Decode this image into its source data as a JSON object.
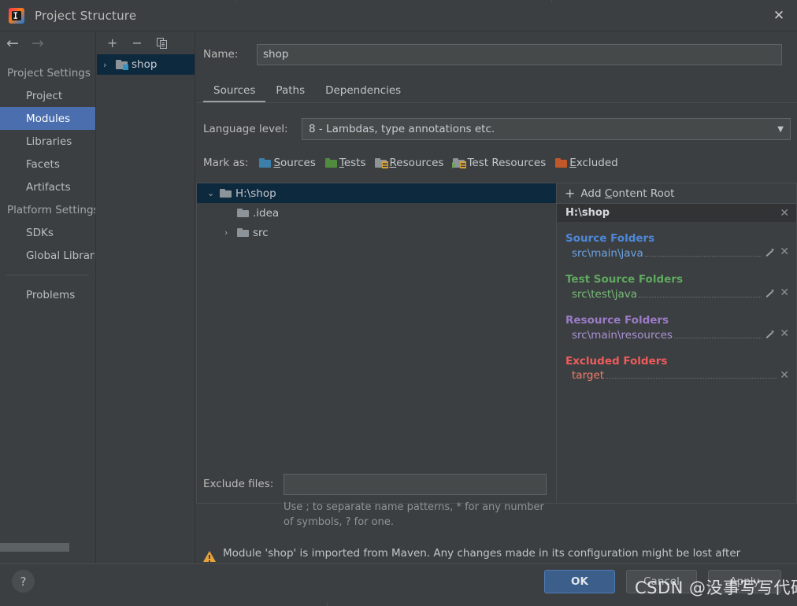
{
  "window": {
    "title": "Project Structure",
    "logo_icon": "intellij-idea-logo",
    "close_icon": "✕"
  },
  "sidebar": {
    "back_icon": "←",
    "forward_icon": "→",
    "groups": [
      {
        "label": "Project Settings",
        "items": [
          {
            "label": "Project",
            "selected": false
          },
          {
            "label": "Modules",
            "selected": true
          },
          {
            "label": "Libraries",
            "selected": false
          },
          {
            "label": "Facets",
            "selected": false
          },
          {
            "label": "Artifacts",
            "selected": false
          }
        ]
      },
      {
        "label": "Platform Settings",
        "items": [
          {
            "label": "SDKs",
            "selected": false
          },
          {
            "label": "Global Libraries",
            "selected": false
          }
        ]
      }
    ],
    "standalone": {
      "label": "Problems"
    }
  },
  "modules_panel": {
    "toolbar": {
      "add": "+",
      "remove": "−",
      "copy_icon": "copy-icon"
    },
    "items": [
      {
        "label": "shop",
        "expand_icon": "›",
        "selected": true,
        "icon": "module-folder-icon"
      }
    ]
  },
  "module_editor": {
    "name_label": "Name:",
    "name_value": "shop",
    "tabs": [
      {
        "label": "Sources",
        "active": true
      },
      {
        "label": "Paths",
        "active": false
      },
      {
        "label": "Dependencies",
        "active": false
      }
    ],
    "language_level_label": "Language level:",
    "language_level_value": "8 - Lambdas, type annotations etc.",
    "mark_as_label": "Mark as:",
    "mark_as_options": [
      {
        "label": "Sources",
        "mnemonic": "S",
        "color": "#3b7faa",
        "kind": "plain"
      },
      {
        "label": "Tests",
        "mnemonic": "T",
        "color": "#518c3e",
        "kind": "plain"
      },
      {
        "label": "Resources",
        "mnemonic": "R",
        "color": "#8d9499",
        "kind": "resource"
      },
      {
        "label": "Test Resources",
        "mnemonic": "",
        "color": "#8d9499",
        "kind": "test-resource"
      },
      {
        "label": "Excluded",
        "mnemonic": "E",
        "color": "#c1582a",
        "kind": "plain"
      }
    ]
  },
  "tree": {
    "rows": [
      {
        "label": "H:\\shop",
        "indent": 0,
        "expand_icon": "⌄",
        "selected": true
      },
      {
        "label": ".idea",
        "indent": 1,
        "expand_icon": "",
        "selected": false
      },
      {
        "label": "src",
        "indent": 1,
        "expand_icon": "›",
        "selected": false
      }
    ]
  },
  "content_roots_panel": {
    "add_content_root": "Add Content Root",
    "add_icon": "+",
    "root_path": "H:\\shop",
    "root_close_icon": "✕",
    "groups": [
      {
        "title": "Source Folders",
        "color": "#4d87d8",
        "entries": [
          {
            "path": "src\\main\\java",
            "color": "#6ba3e0",
            "editable": true,
            "removable": true
          }
        ]
      },
      {
        "title": "Test Source Folders",
        "color": "#5fa85f",
        "entries": [
          {
            "path": "src\\test\\java",
            "color": "#77bb77",
            "editable": true,
            "removable": true
          }
        ]
      },
      {
        "title": "Resource Folders",
        "color": "#9b7bc8",
        "entries": [
          {
            "path": "src\\main\\resources",
            "color": "#ab92d4",
            "editable": true,
            "removable": true
          }
        ]
      },
      {
        "title": "Excluded Folders",
        "color": "#f05b5b",
        "entries": [
          {
            "path": "target",
            "color": "#f37b6a",
            "editable": false,
            "removable": true
          }
        ]
      }
    ]
  },
  "exclude_files": {
    "label": "Exclude files:",
    "value": "",
    "hint": "Use ; to separate name patterns, * for any number of symbols, ? for one."
  },
  "warning": {
    "icon": "warning-icon",
    "text": "Module 'shop' is imported from Maven. Any changes made in its configuration might be lost after reimporting."
  },
  "footer": {
    "help_icon": "?",
    "ok_label": "OK",
    "cancel_label": "Cancel",
    "apply_label": "Apply",
    "watermark": "CSDN @没事写写代码"
  }
}
